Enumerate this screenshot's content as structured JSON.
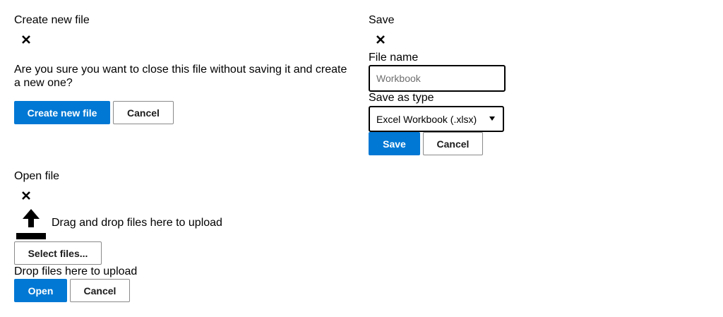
{
  "create_dialog": {
    "title": "Create new file",
    "close_icon": "close-icon",
    "message": "Are you sure you want to close this file without saving it and create a new one?",
    "confirm_label": "Create new file",
    "cancel_label": "Cancel"
  },
  "save_dialog": {
    "title": "Save",
    "close_icon": "close-icon",
    "file_name_label": "File name",
    "file_name_placeholder": "Workbook",
    "file_name_value": "",
    "type_label": "Save as type",
    "type_selected": "Excel Workbook (.xlsx)",
    "save_label": "Save",
    "cancel_label": "Cancel"
  },
  "open_dialog": {
    "title": "Open file",
    "close_icon": "close-icon",
    "upload_icon": "upload-icon",
    "drag_text": "Drag and drop files here to upload",
    "select_label": "Select files...",
    "drop_text": "Drop files here to upload",
    "open_label": "Open",
    "cancel_label": "Cancel"
  },
  "colors": {
    "primary": "#0078d4",
    "border": "#8a8a8a",
    "text": "#000000"
  }
}
